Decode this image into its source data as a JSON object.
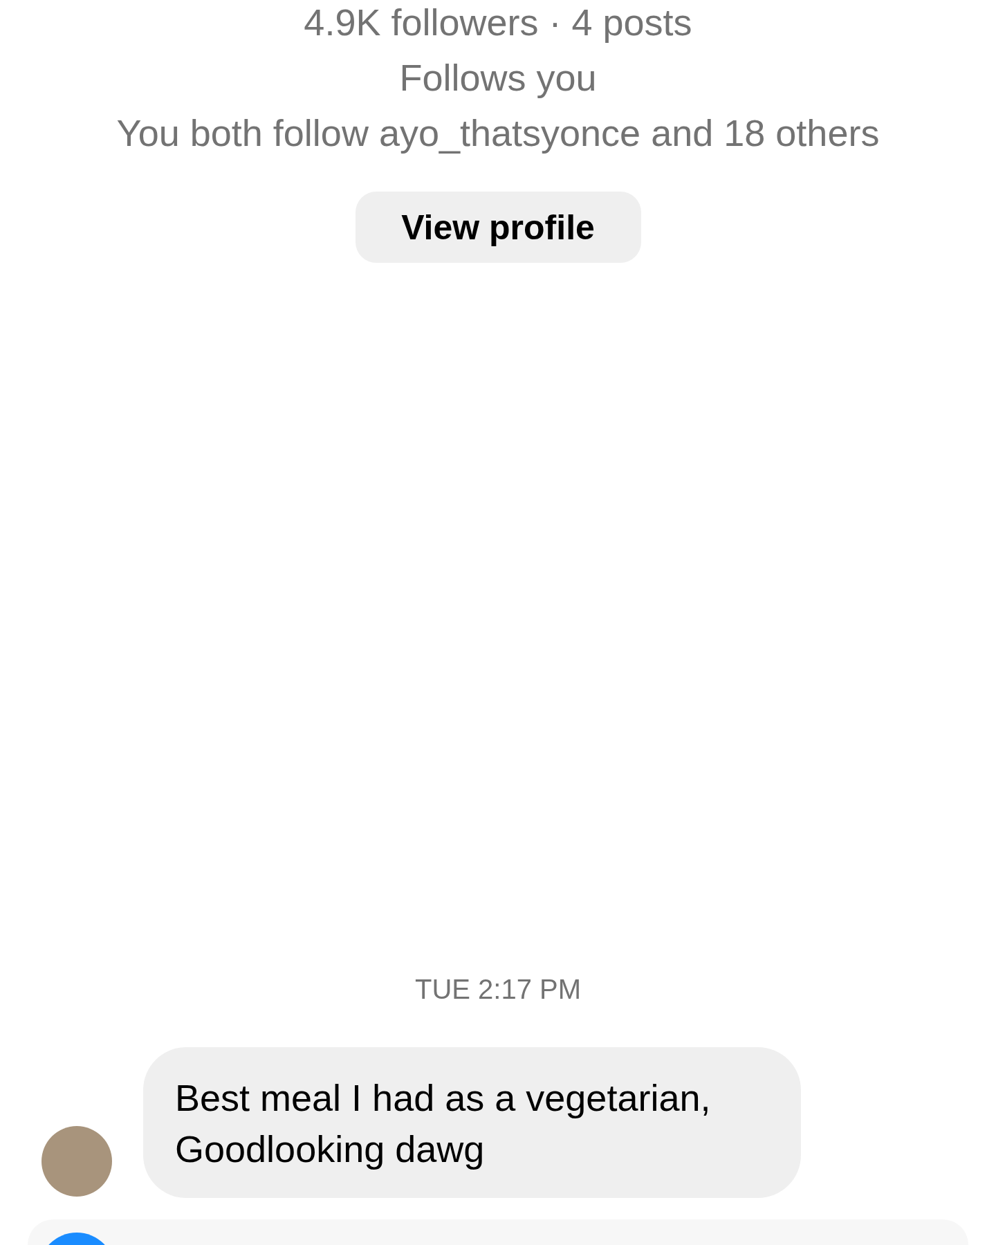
{
  "profile": {
    "stats": "4.9K followers · 4 posts",
    "follow_status": "Follows you",
    "mutuals": "You both follow ayo_thatsyonce and 18 others",
    "button": "View profile"
  },
  "timestamp": "TUE 2:17 PM",
  "messages": [
    {
      "text": "Best meal I had as a vegetarian, Goodlooking dawg",
      "show_avatar": true
    }
  ]
}
